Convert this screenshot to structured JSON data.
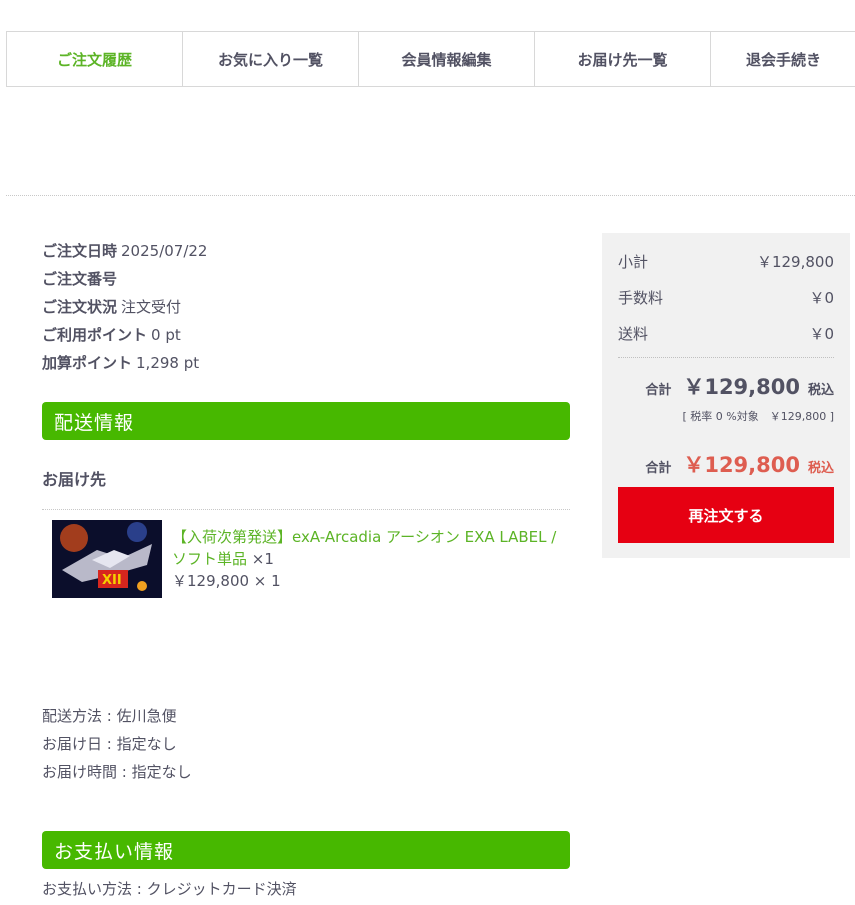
{
  "tabs": [
    "ご注文履歴",
    "お気に入り一覧",
    "会員情報編集",
    "お届け先一覧",
    "退会手続き"
  ],
  "order": {
    "date_label": "ご注文日時",
    "date_value": "2025/07/22",
    "number_label": "ご注文番号",
    "number_value": "",
    "status_label": "ご注文状況",
    "status_value": "注文受付",
    "used_points_label": "ご利用ポイント",
    "used_points_value": "0 pt",
    "added_points_label": "加算ポイント",
    "added_points_value": "1,298 pt"
  },
  "shipping_section": {
    "title": "配送情報",
    "destination_title": "お届け先"
  },
  "product": {
    "name": "【入荷次第発送】exA-Arcadia アーシオン EXA LABEL / ソフト単品",
    "qty": "×1",
    "price_line": "￥129,800 × 1"
  },
  "shipping_details": {
    "method": "配送方法 : 佐川急便",
    "date": "お届け日 : 指定なし",
    "time": "お届け時間 : 指定なし"
  },
  "payment_section": {
    "title": "お支払い情報",
    "method": "お支払い方法 : クレジットカード決済"
  },
  "summary": {
    "subtotal_label": "小計",
    "subtotal_value": "￥129,800",
    "fee_label": "手数料",
    "fee_value": "￥0",
    "shipping_label": "送料",
    "shipping_value": "￥0",
    "total_label": "合計",
    "total_value": "￥129,800",
    "tax_label": "税込",
    "tax_note": "[ 税率 0 %対象　￥129,800 ]",
    "grand_total_label": "合計",
    "grand_total_value": "￥129,800",
    "grand_tax_label": "税込",
    "reorder_button": "再注文する"
  },
  "colors": {
    "accent_green": "#47b800",
    "link_green": "#5cb426",
    "reorder_red": "#e60012",
    "total_red": "#de5d50"
  }
}
